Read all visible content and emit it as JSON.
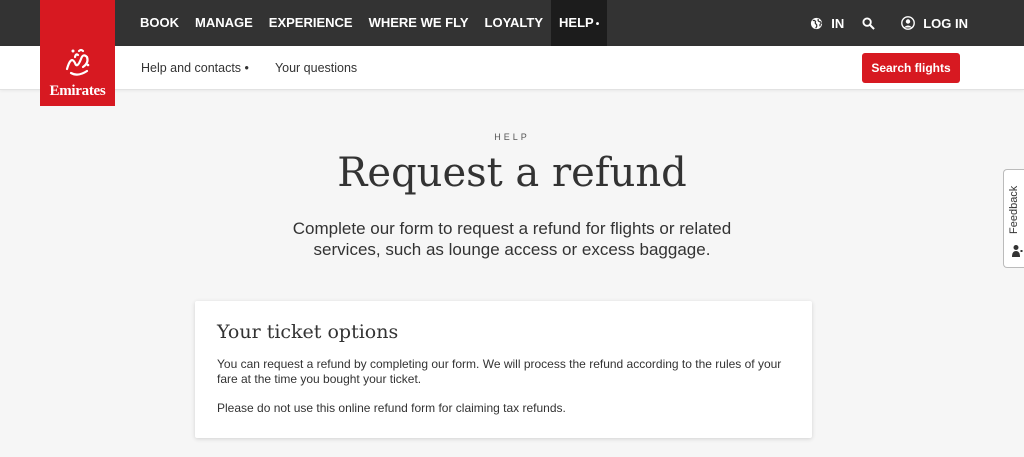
{
  "brand": {
    "logo_text": "Emirates",
    "color": "#d71921"
  },
  "nav": {
    "items": [
      {
        "label": "BOOK"
      },
      {
        "label": "MANAGE"
      },
      {
        "label": "EXPERIENCE"
      },
      {
        "label": "WHERE WE FLY"
      },
      {
        "label": "LOYALTY"
      },
      {
        "label": "HELP"
      }
    ],
    "active_marker": "•"
  },
  "utility": {
    "country_label": "IN",
    "login_label": "LOG IN"
  },
  "subnav": {
    "items": [
      {
        "label": "Help and contacts",
        "marker": "•"
      },
      {
        "label": "Your questions"
      }
    ],
    "cta_label": "Search flights"
  },
  "hero": {
    "eyebrow": "HELP",
    "title": "Request a refund",
    "lead": "Complete our form to request a refund for flights or related services, such as lounge access or excess baggage."
  },
  "card": {
    "title": "Your ticket options",
    "paragraphs": [
      "You can request a refund by completing our form. We will process the refund according to the rules of your fare at the time you bought your ticket.",
      "Please do not use this online refund form for claiming tax refunds."
    ]
  },
  "feedback": {
    "label": "Feedback"
  },
  "icons": {
    "globe": "globe-icon",
    "search": "search-icon",
    "user": "user-icon",
    "feedback": "person-icon",
    "emblem": "emirates-calligraphy-icon"
  },
  "colors": {
    "topbar": "#333333",
    "accent": "#d71921",
    "background": "#f6f6f6"
  }
}
